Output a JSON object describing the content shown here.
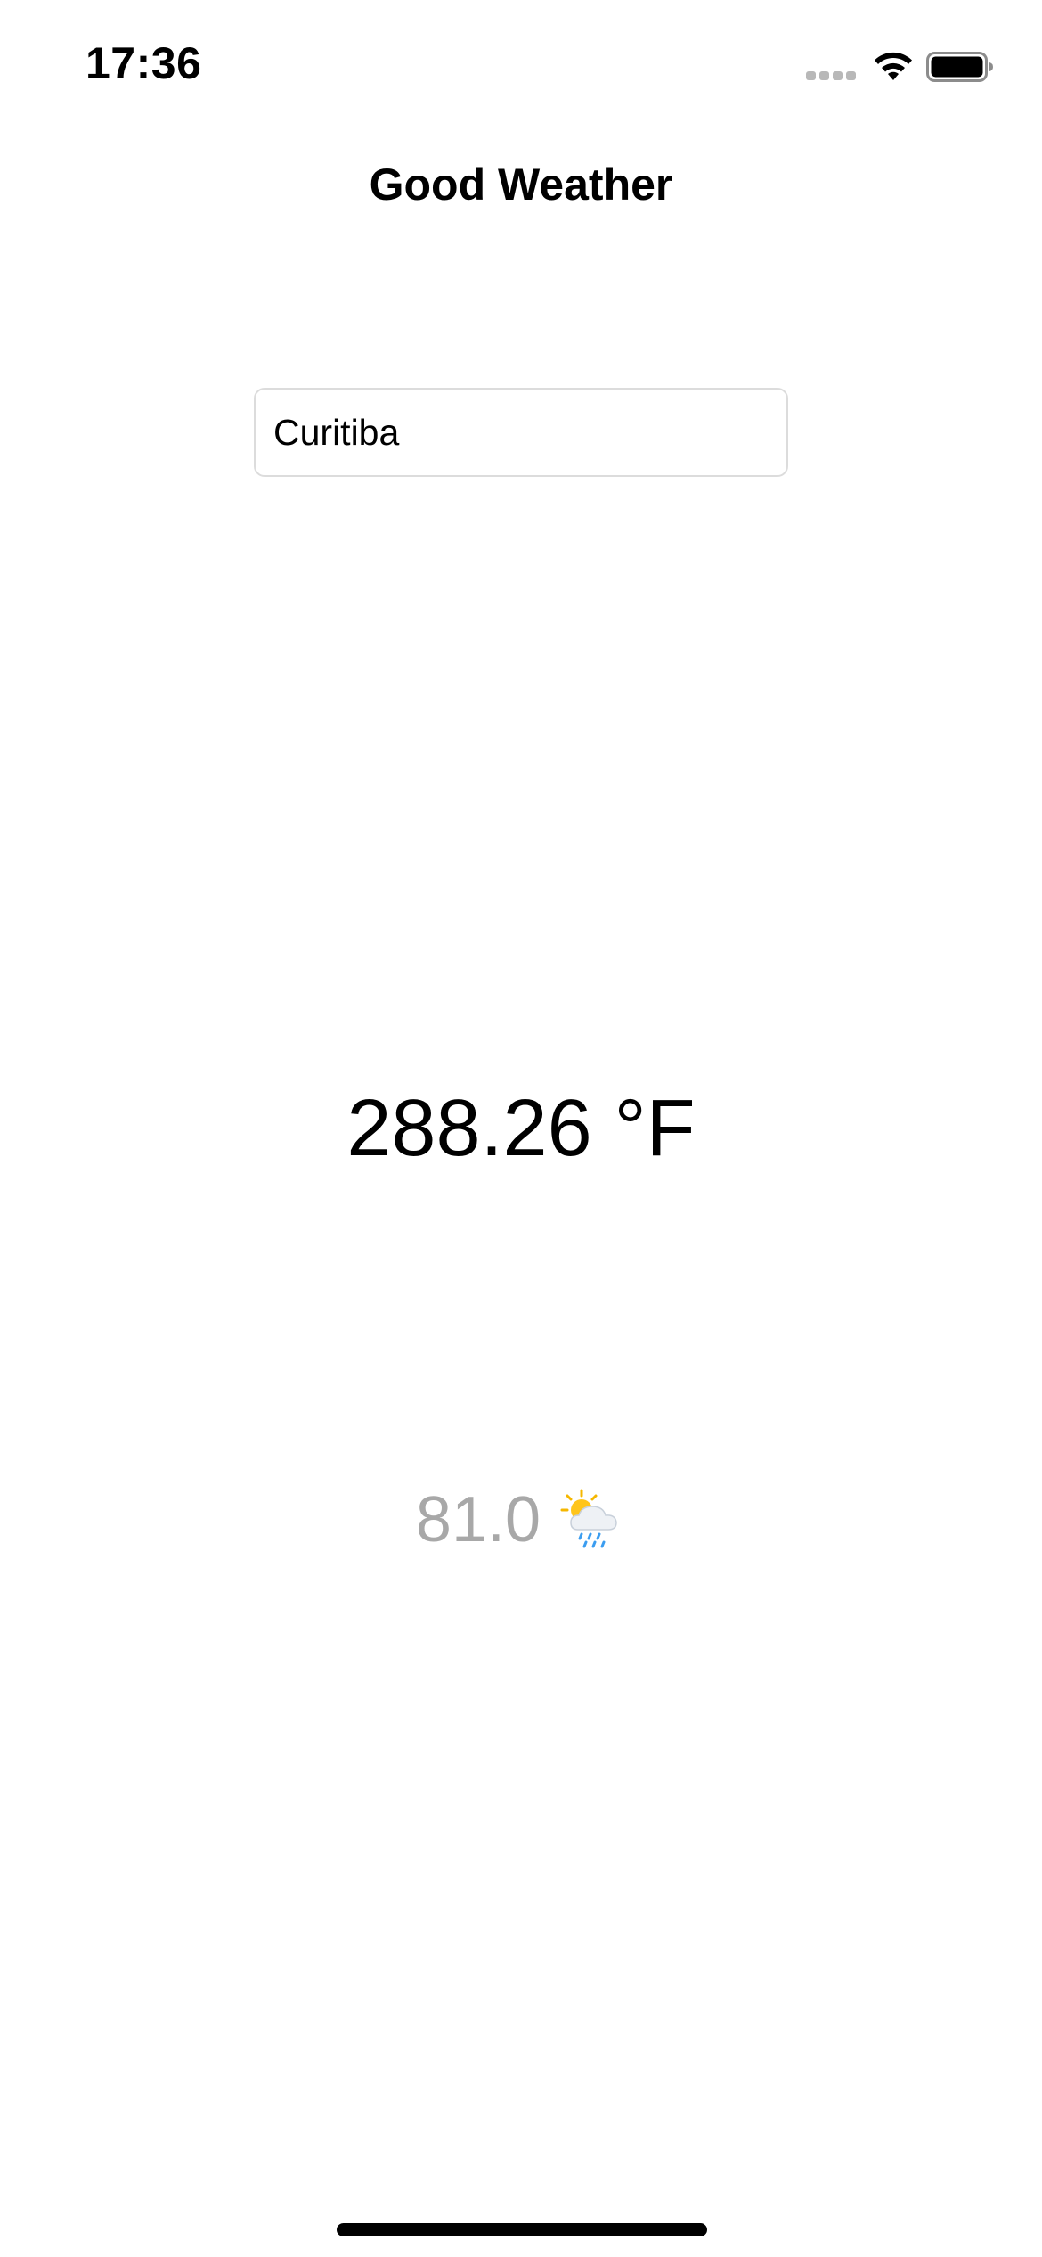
{
  "status_bar": {
    "time": "17:36",
    "icons": [
      "signal-dots-icon",
      "wifi-icon",
      "battery-icon"
    ]
  },
  "nav": {
    "title": "Good Weather"
  },
  "search": {
    "value": "Curitiba",
    "placeholder": ""
  },
  "weather": {
    "temperature": "288.26 °F",
    "secondary_value": "81.0",
    "condition_icon": "sun-behind-rain-cloud-icon"
  },
  "colors": {
    "background": "#ffffff",
    "primary_text": "#000000",
    "secondary_text": "#a8a8a8",
    "input_border": "#dcdcdc"
  }
}
